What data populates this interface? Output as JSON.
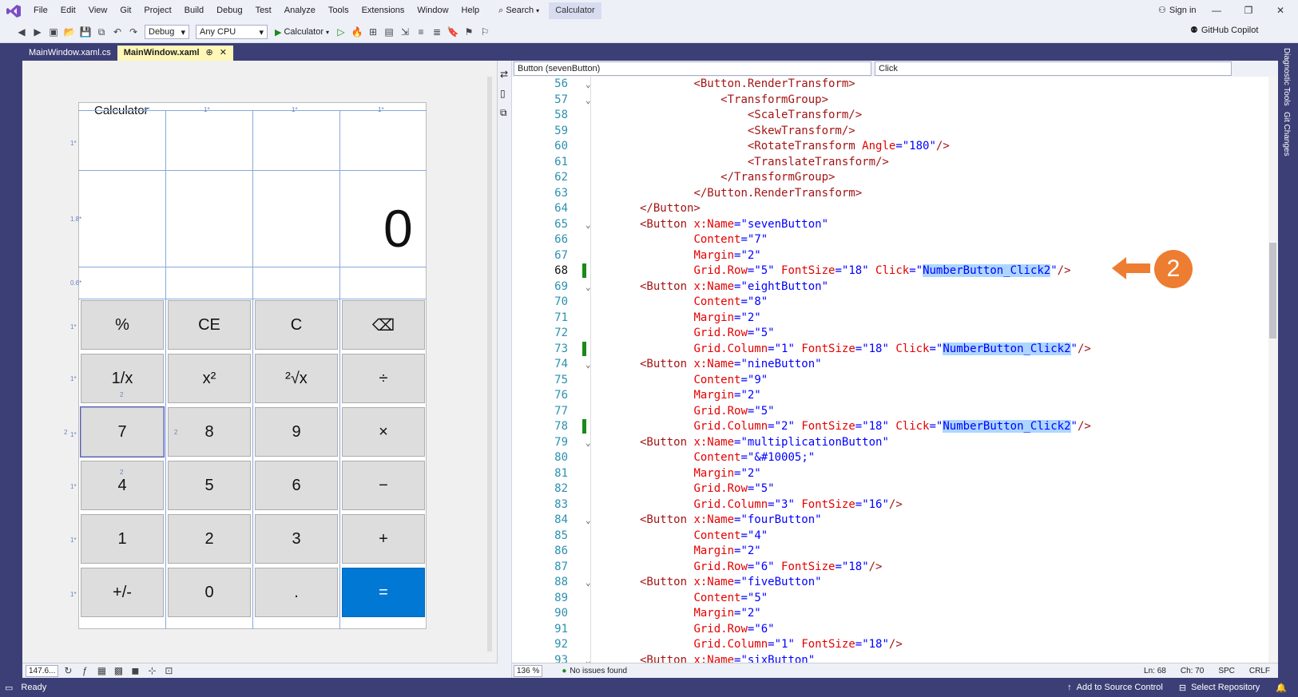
{
  "menu": [
    "File",
    "Edit",
    "View",
    "Git",
    "Project",
    "Build",
    "Debug",
    "Test",
    "Analyze",
    "Tools",
    "Extensions",
    "Window",
    "Help"
  ],
  "search_label": "Search",
  "solution_name": "Calculator",
  "signin_label": "Sign in",
  "toolbar": {
    "config": "Debug",
    "platform": "Any CPU",
    "run_label": "Calculator"
  },
  "copilot_label": "GitHub Copilot",
  "rail": [
    "Diagnostic Tools",
    "Git Changes"
  ],
  "tabs": {
    "first": "MainWindow.xaml.cs",
    "active": "MainWindow.xaml",
    "pin": "⊕",
    "close": "✕"
  },
  "designer": {
    "window_title": "Calculator",
    "display_value": "0",
    "zoom": "147.6...",
    "buttons": [
      "%",
      "CE",
      "C",
      "⌫",
      "1/x",
      "x²",
      "²√x",
      "÷",
      "7",
      "8",
      "9",
      "×",
      "4",
      "5",
      "6",
      "−",
      "1",
      "2",
      "3",
      "+",
      "+/-",
      "0",
      ".",
      "="
    ],
    "grid_marks": [
      "1*",
      "1*",
      "1*",
      "1*",
      "1*",
      "1.8*",
      "0.6*",
      "1*",
      "1*",
      "1*",
      "1*",
      "1*",
      "1*",
      "2",
      "2",
      "2",
      "2"
    ]
  },
  "editor": {
    "nav_left": "Button (sevenButton)",
    "nav_right": "Click",
    "lines": [
      {
        "n": "56",
        "c": [
          [
            "        ",
            ""
          ],
          [
            "<Button.RenderTransform>",
            "tg"
          ]
        ]
      },
      {
        "n": "57",
        "c": [
          [
            "            ",
            ""
          ],
          [
            "<TransformGroup>",
            "tg"
          ]
        ]
      },
      {
        "n": "58",
        "c": [
          [
            "                ",
            ""
          ],
          [
            "<ScaleTransform/>",
            "tg"
          ]
        ]
      },
      {
        "n": "59",
        "c": [
          [
            "                ",
            ""
          ],
          [
            "<SkewTransform/>",
            "tg"
          ]
        ]
      },
      {
        "n": "60",
        "c": [
          [
            "                ",
            ""
          ],
          [
            "<RotateTransform ",
            "tg"
          ],
          [
            "Angle",
            "at"
          ],
          [
            "=",
            "pn"
          ],
          [
            "\"180\"",
            "av"
          ],
          [
            "/>",
            "tg"
          ]
        ]
      },
      {
        "n": "61",
        "c": [
          [
            "                ",
            ""
          ],
          [
            "<TranslateTransform/>",
            "tg"
          ]
        ]
      },
      {
        "n": "62",
        "c": [
          [
            "            ",
            ""
          ],
          [
            "</TransformGroup>",
            "tg"
          ]
        ]
      },
      {
        "n": "63",
        "c": [
          [
            "        ",
            ""
          ],
          [
            "</Button.RenderTransform>",
            "tg"
          ]
        ]
      },
      {
        "n": "64",
        "c": [
          [
            "</Button>",
            "tg"
          ]
        ]
      },
      {
        "n": "65",
        "c": [
          [
            "<Button ",
            "tg"
          ],
          [
            "x:Name",
            "at"
          ],
          [
            "=",
            "pn"
          ],
          [
            "\"sevenButton\"",
            "av"
          ]
        ]
      },
      {
        "n": "66",
        "c": [
          [
            "        ",
            ""
          ],
          [
            "Content",
            "at"
          ],
          [
            "=",
            "pn"
          ],
          [
            "\"7\"",
            "av"
          ]
        ]
      },
      {
        "n": "67",
        "c": [
          [
            "        ",
            ""
          ],
          [
            "Margin",
            "at"
          ],
          [
            "=",
            "pn"
          ],
          [
            "\"2\"",
            "av"
          ]
        ]
      },
      {
        "n": "68",
        "c": [
          [
            "        ",
            ""
          ],
          [
            "Grid.Row",
            "at"
          ],
          [
            "=",
            "pn"
          ],
          [
            "\"5\"",
            "av"
          ],
          [
            " FontSize",
            "at"
          ],
          [
            "=",
            "pn"
          ],
          [
            "\"18\"",
            "av"
          ],
          [
            " Click",
            "at"
          ],
          [
            "=",
            "pn"
          ],
          [
            "\"",
            "av"
          ],
          [
            "NumberButton_Click2",
            "av hl"
          ],
          [
            "\"",
            "av"
          ],
          [
            "/>",
            "tg"
          ]
        ]
      },
      {
        "n": "69",
        "c": [
          [
            "<Button ",
            "tg"
          ],
          [
            "x:Name",
            "at"
          ],
          [
            "=",
            "pn"
          ],
          [
            "\"eightButton\"",
            "av"
          ]
        ]
      },
      {
        "n": "70",
        "c": [
          [
            "        ",
            ""
          ],
          [
            "Content",
            "at"
          ],
          [
            "=",
            "pn"
          ],
          [
            "\"8\"",
            "av"
          ]
        ]
      },
      {
        "n": "71",
        "c": [
          [
            "        ",
            ""
          ],
          [
            "Margin",
            "at"
          ],
          [
            "=",
            "pn"
          ],
          [
            "\"2\"",
            "av"
          ]
        ]
      },
      {
        "n": "72",
        "c": [
          [
            "        ",
            ""
          ],
          [
            "Grid.Row",
            "at"
          ],
          [
            "=",
            "pn"
          ],
          [
            "\"5\"",
            "av"
          ]
        ]
      },
      {
        "n": "73",
        "c": [
          [
            "        ",
            ""
          ],
          [
            "Grid.Column",
            "at"
          ],
          [
            "=",
            "pn"
          ],
          [
            "\"1\"",
            "av"
          ],
          [
            " FontSize",
            "at"
          ],
          [
            "=",
            "pn"
          ],
          [
            "\"18\"",
            "av"
          ],
          [
            " Click",
            "at"
          ],
          [
            "=",
            "pn"
          ],
          [
            "\"",
            "av"
          ],
          [
            "NumberButton_Click2",
            "av hl"
          ],
          [
            "\"",
            "av"
          ],
          [
            "/>",
            "tg"
          ]
        ]
      },
      {
        "n": "74",
        "c": [
          [
            "<Button ",
            "tg"
          ],
          [
            "x:Name",
            "at"
          ],
          [
            "=",
            "pn"
          ],
          [
            "\"nineButton\"",
            "av"
          ]
        ]
      },
      {
        "n": "75",
        "c": [
          [
            "        ",
            ""
          ],
          [
            "Content",
            "at"
          ],
          [
            "=",
            "pn"
          ],
          [
            "\"9\"",
            "av"
          ]
        ]
      },
      {
        "n": "76",
        "c": [
          [
            "        ",
            ""
          ],
          [
            "Margin",
            "at"
          ],
          [
            "=",
            "pn"
          ],
          [
            "\"2\"",
            "av"
          ]
        ]
      },
      {
        "n": "77",
        "c": [
          [
            "        ",
            ""
          ],
          [
            "Grid.Row",
            "at"
          ],
          [
            "=",
            "pn"
          ],
          [
            "\"5\"",
            "av"
          ]
        ]
      },
      {
        "n": "78",
        "c": [
          [
            "        ",
            ""
          ],
          [
            "Grid.Column",
            "at"
          ],
          [
            "=",
            "pn"
          ],
          [
            "\"2\"",
            "av"
          ],
          [
            " FontSize",
            "at"
          ],
          [
            "=",
            "pn"
          ],
          [
            "\"18\"",
            "av"
          ],
          [
            " Click",
            "at"
          ],
          [
            "=",
            "pn"
          ],
          [
            "\"",
            "av"
          ],
          [
            "NumberButton_Click2",
            "av hl"
          ],
          [
            "\"",
            "av"
          ],
          [
            "/>",
            "tg"
          ]
        ]
      },
      {
        "n": "79",
        "c": [
          [
            "<Button ",
            "tg"
          ],
          [
            "x:Name",
            "at"
          ],
          [
            "=",
            "pn"
          ],
          [
            "\"multiplicationButton\"",
            "av"
          ]
        ]
      },
      {
        "n": "80",
        "c": [
          [
            "        ",
            ""
          ],
          [
            "Content",
            "at"
          ],
          [
            "=",
            "pn"
          ],
          [
            "\"&#10005;\"",
            "av"
          ]
        ]
      },
      {
        "n": "81",
        "c": [
          [
            "        ",
            ""
          ],
          [
            "Margin",
            "at"
          ],
          [
            "=",
            "pn"
          ],
          [
            "\"2\"",
            "av"
          ]
        ]
      },
      {
        "n": "82",
        "c": [
          [
            "        ",
            ""
          ],
          [
            "Grid.Row",
            "at"
          ],
          [
            "=",
            "pn"
          ],
          [
            "\"5\"",
            "av"
          ]
        ]
      },
      {
        "n": "83",
        "c": [
          [
            "        ",
            ""
          ],
          [
            "Grid.Column",
            "at"
          ],
          [
            "=",
            "pn"
          ],
          [
            "\"3\"",
            "av"
          ],
          [
            " FontSize",
            "at"
          ],
          [
            "=",
            "pn"
          ],
          [
            "\"16\"",
            "av"
          ],
          [
            "/>",
            "tg"
          ]
        ]
      },
      {
        "n": "84",
        "c": [
          [
            "<Button ",
            "tg"
          ],
          [
            "x:Name",
            "at"
          ],
          [
            "=",
            "pn"
          ],
          [
            "\"fourButton\"",
            "av"
          ]
        ]
      },
      {
        "n": "85",
        "c": [
          [
            "        ",
            ""
          ],
          [
            "Content",
            "at"
          ],
          [
            "=",
            "pn"
          ],
          [
            "\"4\"",
            "av"
          ]
        ]
      },
      {
        "n": "86",
        "c": [
          [
            "        ",
            ""
          ],
          [
            "Margin",
            "at"
          ],
          [
            "=",
            "pn"
          ],
          [
            "\"2\"",
            "av"
          ]
        ]
      },
      {
        "n": "87",
        "c": [
          [
            "        ",
            ""
          ],
          [
            "Grid.Row",
            "at"
          ],
          [
            "=",
            "pn"
          ],
          [
            "\"6\"",
            "av"
          ],
          [
            " FontSize",
            "at"
          ],
          [
            "=",
            "pn"
          ],
          [
            "\"18\"",
            "av"
          ],
          [
            "/>",
            "tg"
          ]
        ]
      },
      {
        "n": "88",
        "c": [
          [
            "<Button ",
            "tg"
          ],
          [
            "x:Name",
            "at"
          ],
          [
            "=",
            "pn"
          ],
          [
            "\"fiveButton\"",
            "av"
          ]
        ]
      },
      {
        "n": "89",
        "c": [
          [
            "        ",
            ""
          ],
          [
            "Content",
            "at"
          ],
          [
            "=",
            "pn"
          ],
          [
            "\"5\"",
            "av"
          ]
        ]
      },
      {
        "n": "90",
        "c": [
          [
            "        ",
            ""
          ],
          [
            "Margin",
            "at"
          ],
          [
            "=",
            "pn"
          ],
          [
            "\"2\"",
            "av"
          ]
        ]
      },
      {
        "n": "91",
        "c": [
          [
            "        ",
            ""
          ],
          [
            "Grid.Row",
            "at"
          ],
          [
            "=",
            "pn"
          ],
          [
            "\"6\"",
            "av"
          ]
        ]
      },
      {
        "n": "92",
        "c": [
          [
            "        ",
            ""
          ],
          [
            "Grid.Column",
            "at"
          ],
          [
            "=",
            "pn"
          ],
          [
            "\"1\"",
            "av"
          ],
          [
            " FontSize",
            "at"
          ],
          [
            "=",
            "pn"
          ],
          [
            "\"18\"",
            "av"
          ],
          [
            "/>",
            "tg"
          ]
        ]
      },
      {
        "n": "93",
        "c": [
          [
            "<Button ",
            "tg"
          ],
          [
            "x:Name",
            "at"
          ],
          [
            "=",
            "pn"
          ],
          [
            "\"sixButton\"",
            "av"
          ]
        ]
      }
    ],
    "current_line": "68",
    "changed_lines": [
      "68",
      "73",
      "78"
    ],
    "fold_lines": [
      "56",
      "57",
      "65",
      "69",
      "74",
      "79",
      "84",
      "88",
      "93"
    ],
    "zoom": "136 %",
    "issues": "No issues found",
    "ln": "Ln: 68",
    "ch": "Ch: 70",
    "spc": "SPC",
    "crlf": "CRLF"
  },
  "callout_number": "2",
  "colors": {
    "accent": "#3c3f76",
    "callout": "#ed7d31",
    "eq_button": "#0078d4"
  },
  "status": {
    "ready": "Ready",
    "source_control": "Add to Source Control",
    "repo": "Select Repository"
  }
}
